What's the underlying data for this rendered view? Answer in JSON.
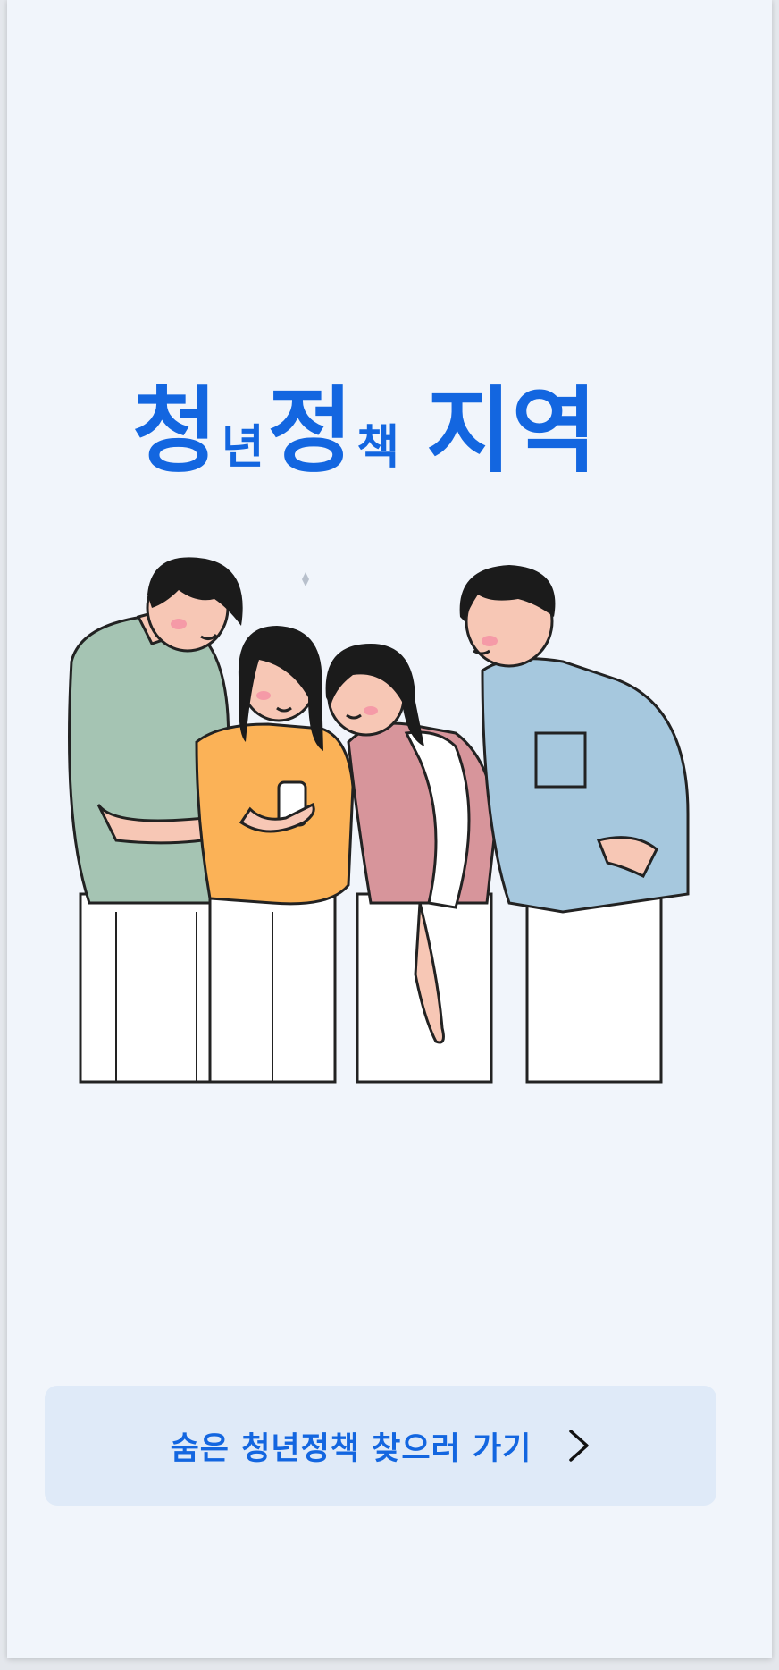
{
  "hero": {
    "title_parts": [
      "청",
      "년",
      "정",
      "책",
      "지역"
    ]
  },
  "illustration": {
    "icon": "people-looking-at-phone-illustration"
  },
  "cta": {
    "label": "숨은 청년정책 찾으러 가기",
    "icon": "chevron-right-icon"
  },
  "colors": {
    "accent": "#1366e0",
    "background": "#f1f5fb",
    "button_bg": "#dfeaf8"
  }
}
